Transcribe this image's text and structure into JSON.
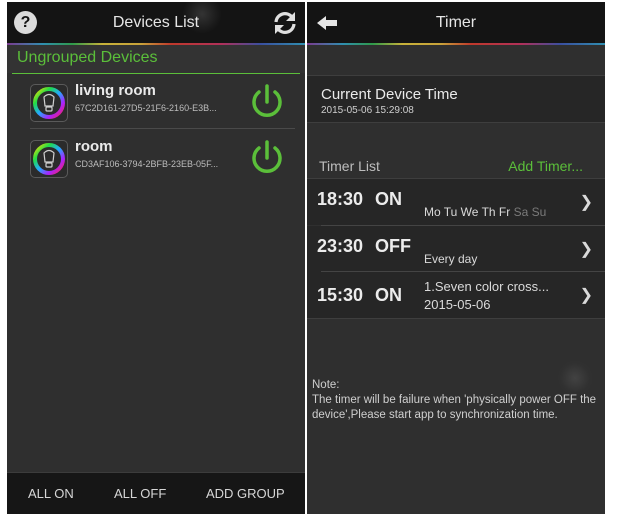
{
  "left": {
    "header": {
      "title": "Devices List",
      "help_icon": "question-mark-icon",
      "refresh_icon": "refresh-icon"
    },
    "section": {
      "title": "Ungrouped Devices"
    },
    "devices": [
      {
        "name": "living room",
        "id": "67C2D161-27D5-21F6-2160-E3B..."
      },
      {
        "name": "room",
        "id": "CD3AF106-3794-2BFB-23EB-05F..."
      }
    ],
    "bottom_bar": {
      "all_on": "ALL ON",
      "all_off": "ALL OFF",
      "add_group": "ADD GROUP"
    }
  },
  "right": {
    "header": {
      "title": "Timer",
      "back_icon": "back-arrow-icon"
    },
    "current_time": {
      "label": "Current Device Time",
      "value": "2015-05-06 15:29:08"
    },
    "timer_list": {
      "label": "Timer List",
      "add_label": "Add Timer..."
    },
    "timers": [
      {
        "time": "18:30",
        "state": "ON",
        "days_active": "Mo Tu We Th Fr",
        "days_inactive": "Sa Su",
        "line2": ""
      },
      {
        "time": "23:30",
        "state": "OFF",
        "days_active": "Every day",
        "days_inactive": "",
        "line2": ""
      },
      {
        "time": "15:30",
        "state": "ON",
        "days_active": "1.Seven color cross...",
        "days_inactive": "",
        "line2": "2015-05-06"
      }
    ],
    "note": {
      "title": "Note:",
      "body": "The timer will be failure when 'physically power OFF the device',Please start app to synchronization time."
    }
  },
  "colors": {
    "accent_green": "#5bbf3a",
    "bar_dark": "#141414",
    "panel_bg": "#2f2f2f"
  }
}
